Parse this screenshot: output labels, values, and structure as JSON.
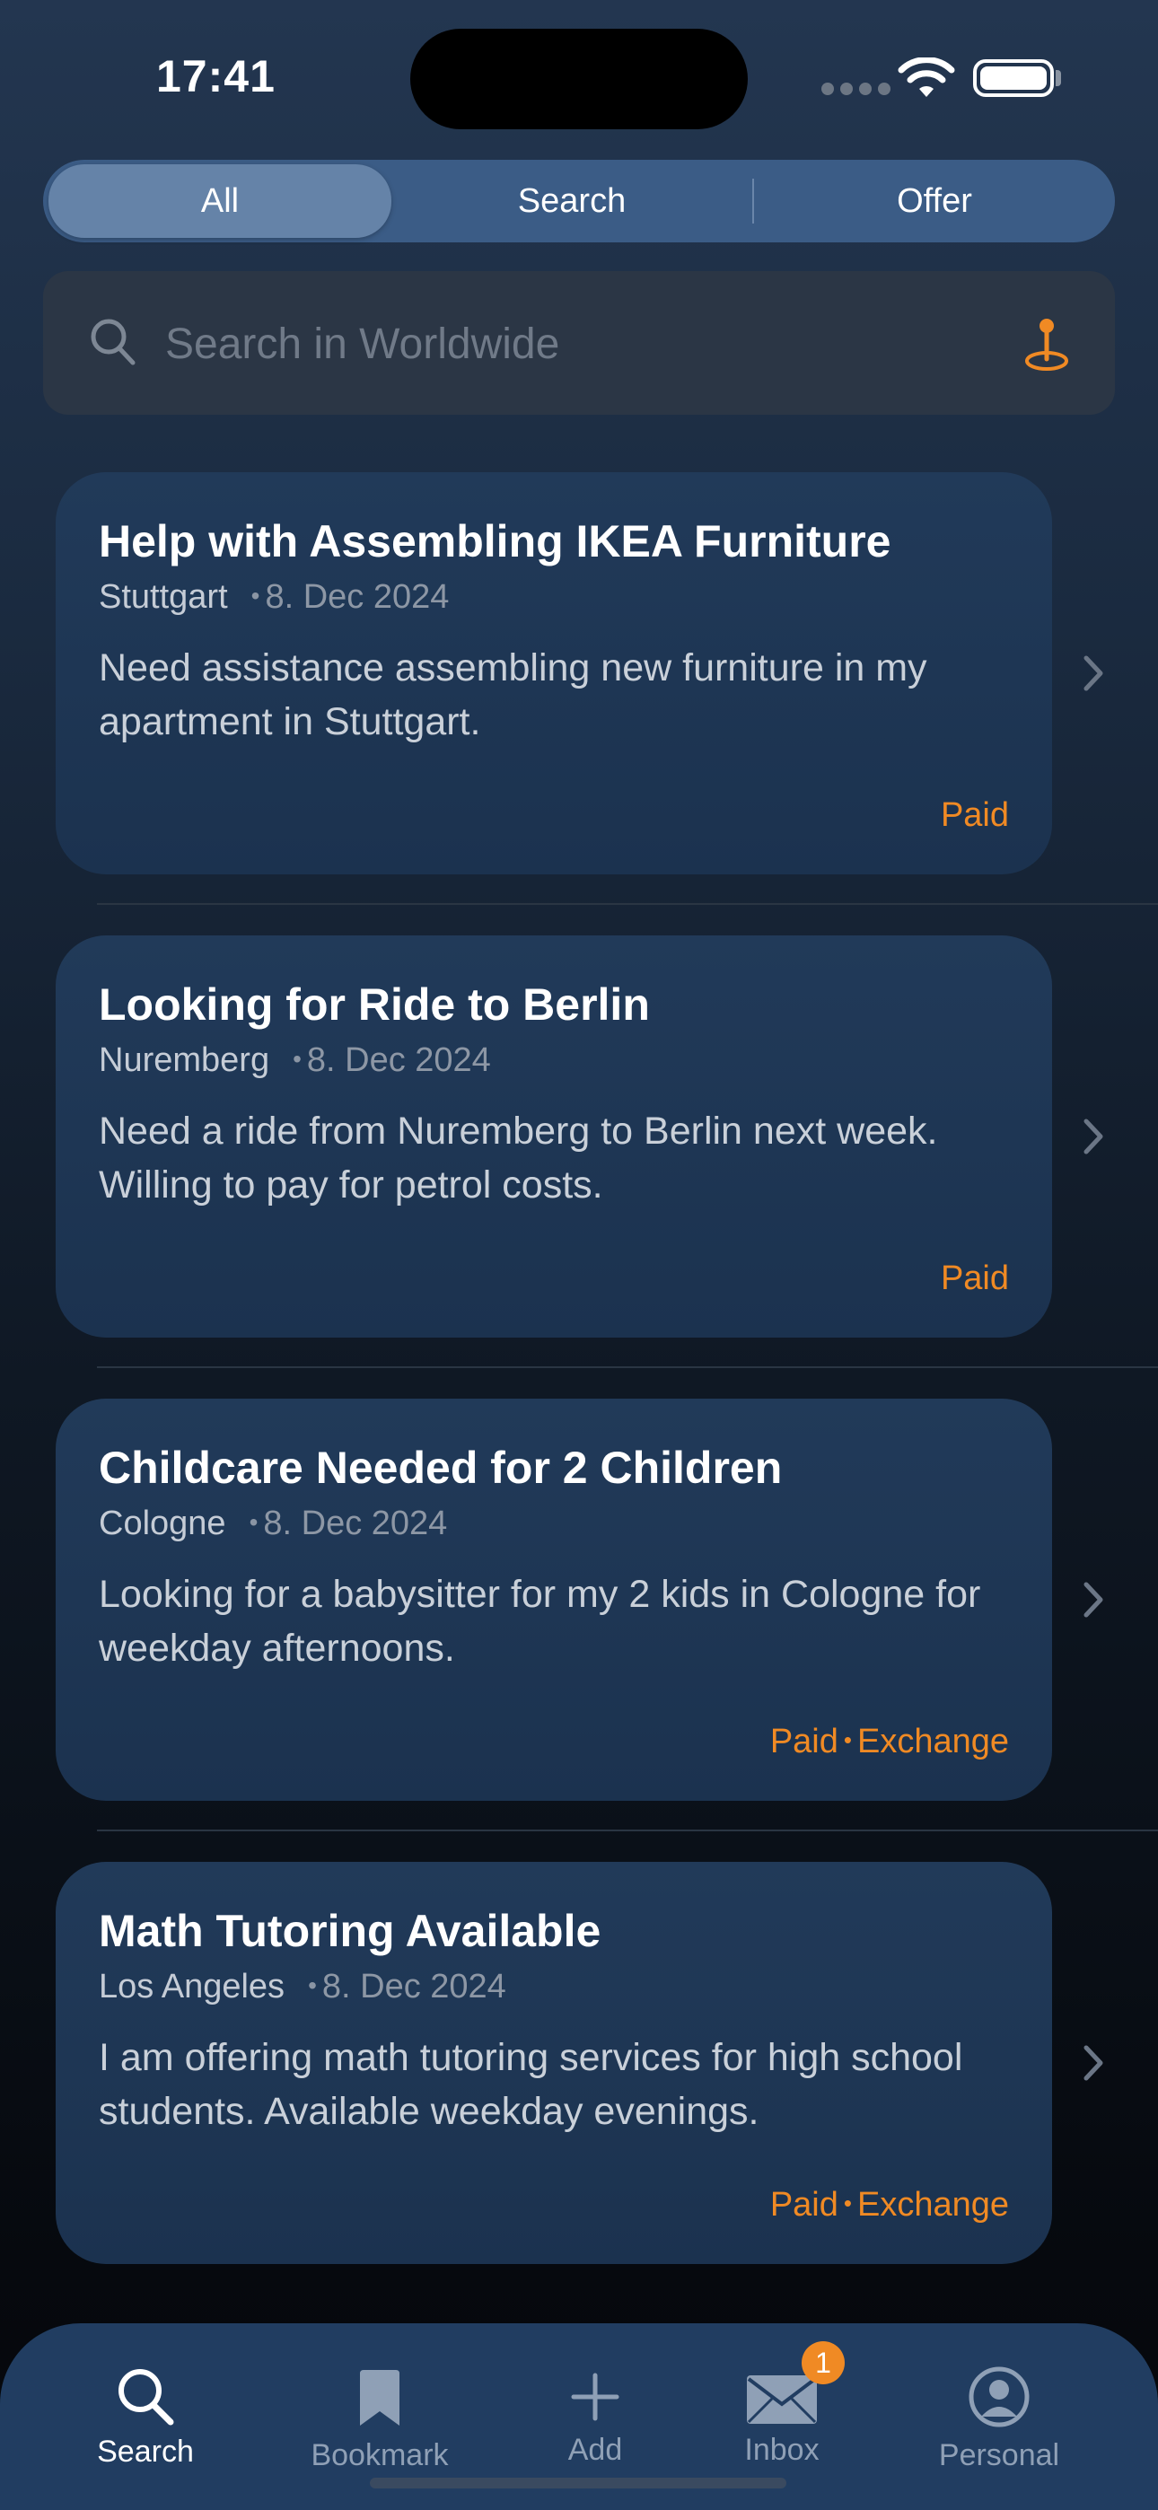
{
  "status_bar": {
    "time": "17:41"
  },
  "segments": [
    {
      "label": "All",
      "active": true
    },
    {
      "label": "Search",
      "active": false
    },
    {
      "label": "Offer",
      "active": false
    }
  ],
  "search": {
    "placeholder": "Search in Worldwide",
    "value": ""
  },
  "colors": {
    "accent": "#f08a24",
    "card_bg": "#1d3553",
    "tab_bar_bg": "#213d61"
  },
  "posts": [
    {
      "title": "Help with Assembling IKEA Furniture",
      "city": "Stuttgart",
      "date": "8. Dec 2024",
      "description": "Need assistance assembling new furniture in my apartment in Stuttgart.",
      "tags": [
        "Paid"
      ]
    },
    {
      "title": "Looking for Ride to Berlin",
      "city": "Nuremberg",
      "date": "8. Dec 2024",
      "description": "Need a ride from Nuremberg to Berlin next week. Willing to pay for petrol costs.",
      "tags": [
        "Paid"
      ]
    },
    {
      "title": "Childcare Needed for 2 Children",
      "city": "Cologne",
      "date": "8. Dec 2024",
      "description": "Looking for a babysitter for my 2 kids in Cologne for weekday afternoons.",
      "tags": [
        "Paid",
        "Exchange"
      ]
    },
    {
      "title": "Math Tutoring Available",
      "city": "Los Angeles",
      "date": "8. Dec 2024",
      "description": "I am offering math tutoring services for high school students. Available weekday evenings.",
      "tags": [
        "Paid",
        "Exchange"
      ]
    }
  ],
  "tab_bar": {
    "tabs": [
      {
        "label": "Search",
        "icon": "search-icon",
        "active": true
      },
      {
        "label": "Bookmark",
        "icon": "bookmark-icon",
        "active": false
      },
      {
        "label": "Add",
        "icon": "plus-icon",
        "active": false
      },
      {
        "label": "Inbox",
        "icon": "envelope-icon",
        "active": false,
        "badge": "1"
      },
      {
        "label": "Personal",
        "icon": "person-circle-icon",
        "active": false
      }
    ]
  }
}
